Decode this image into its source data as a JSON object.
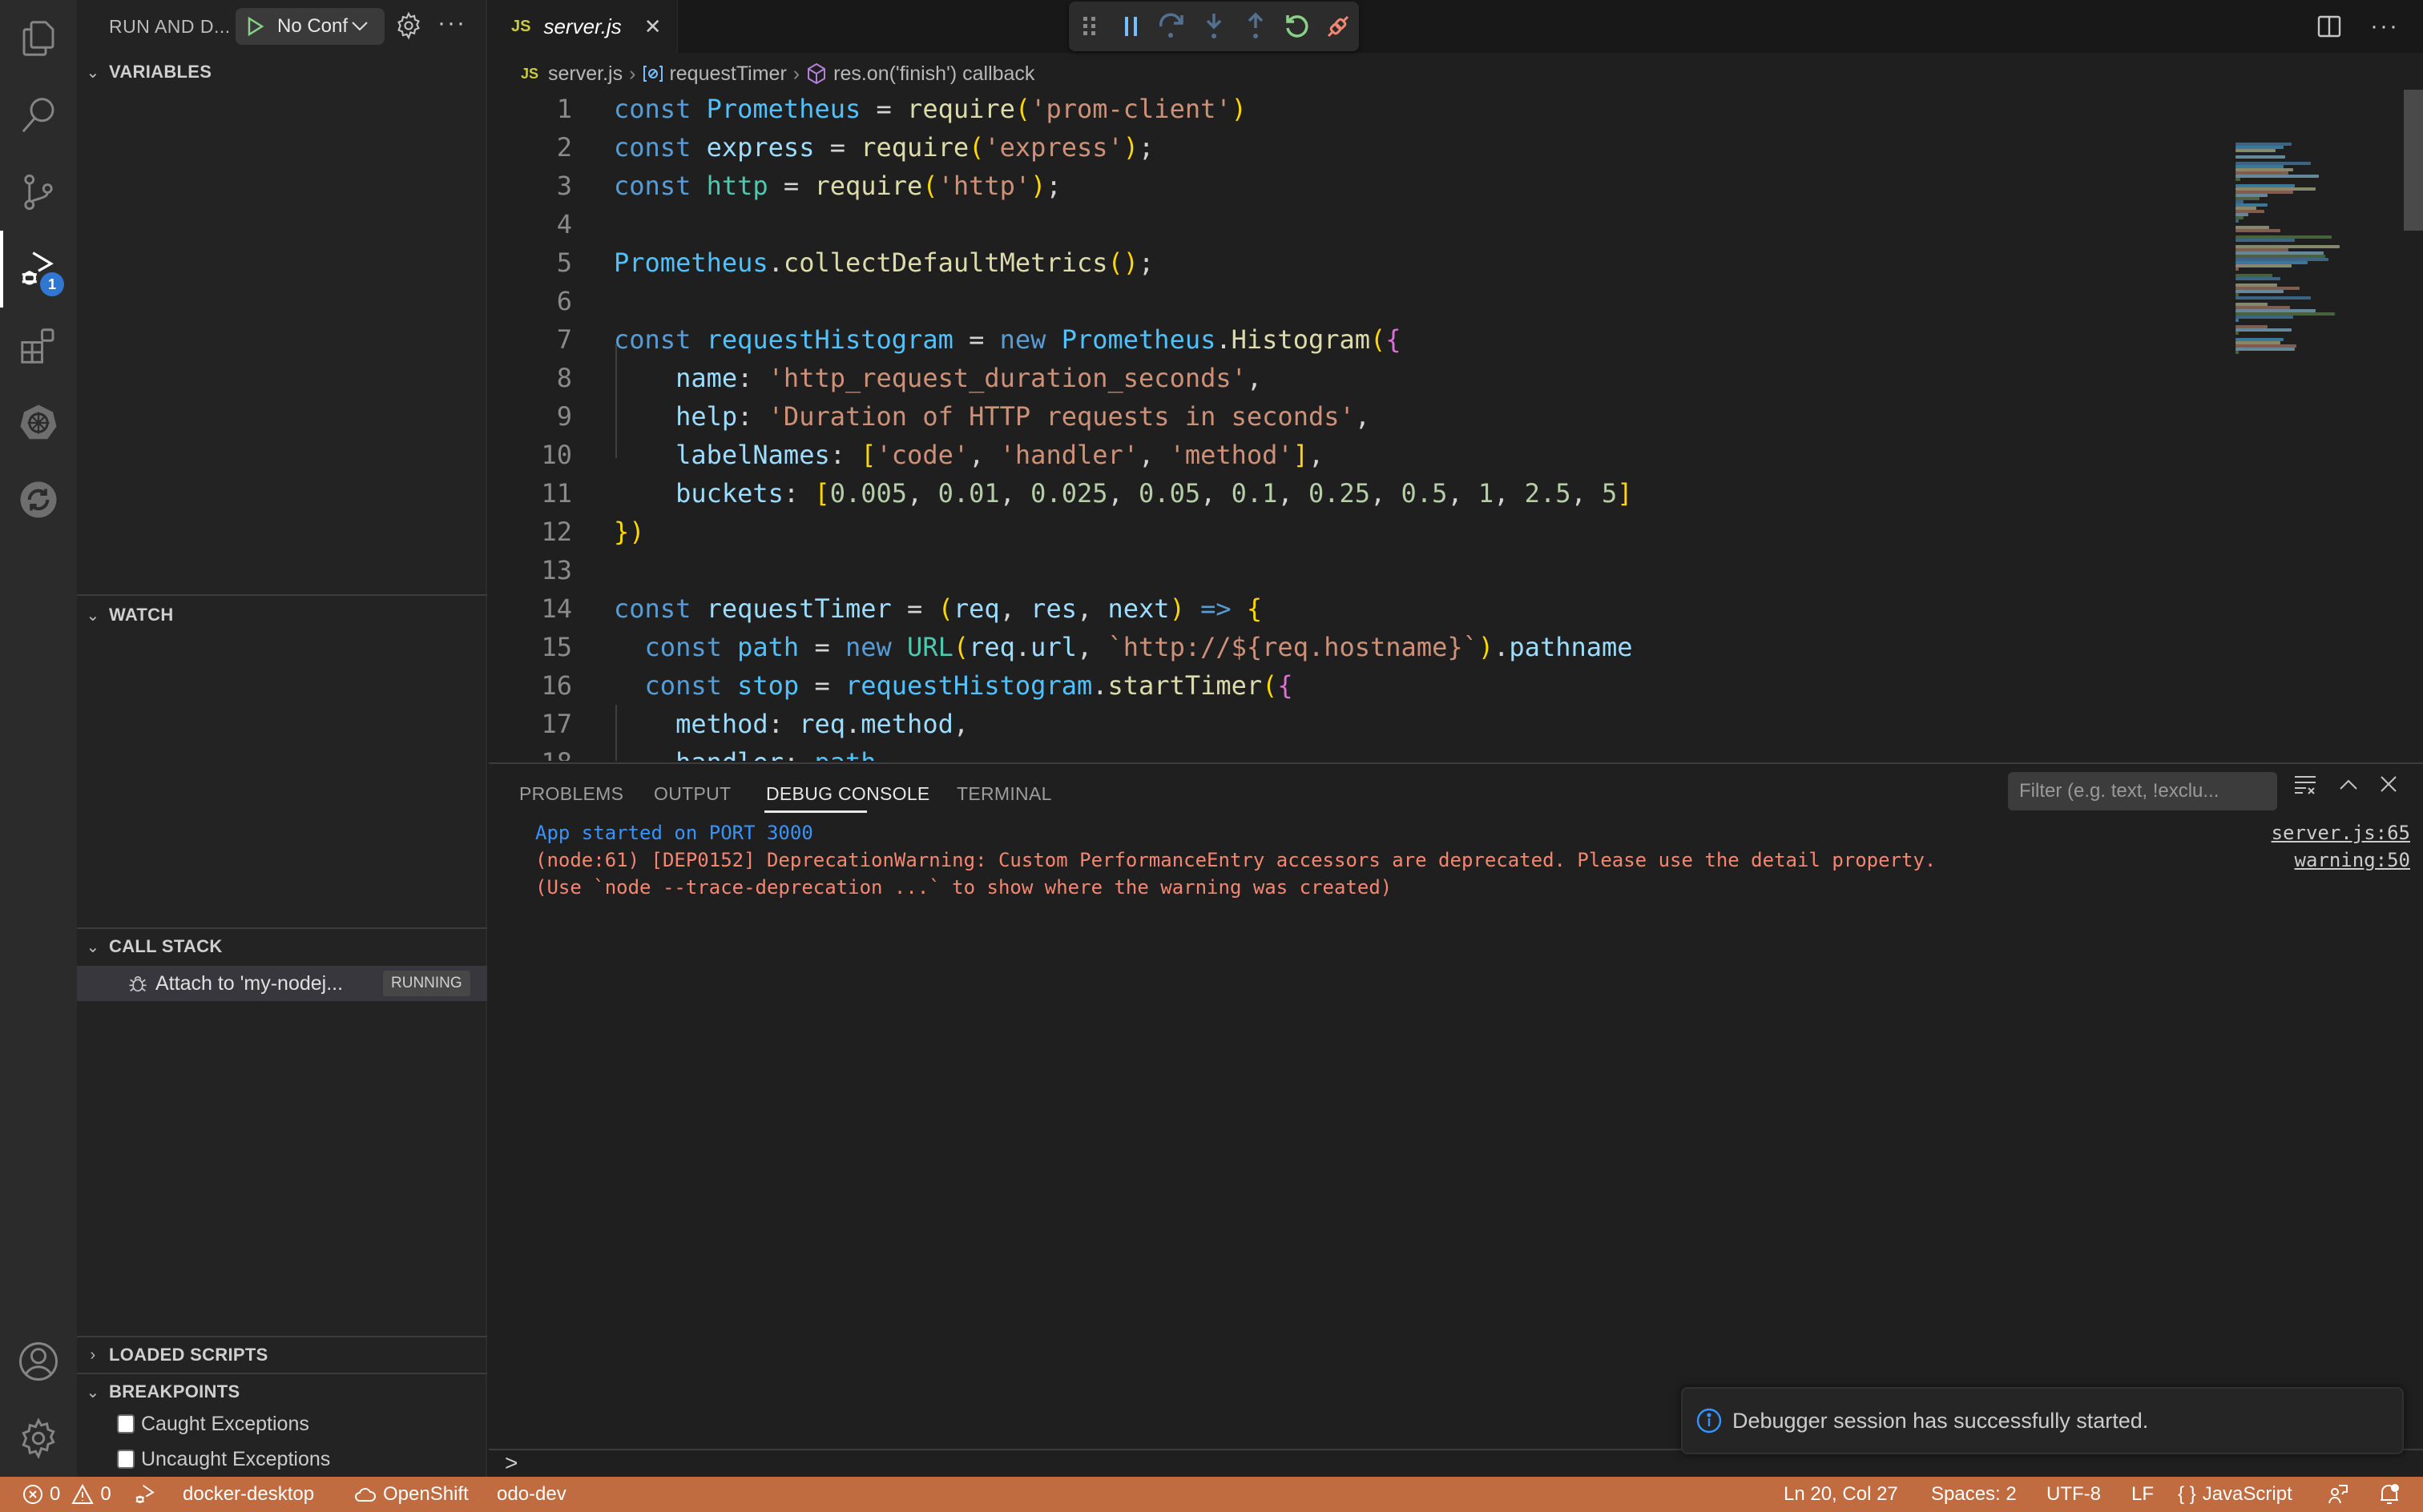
{
  "activity_bar": {
    "items": [
      {
        "name": "explorer",
        "icon": "files-icon"
      },
      {
        "name": "search",
        "icon": "search-icon"
      },
      {
        "name": "source-control",
        "icon": "source-control-icon"
      },
      {
        "name": "run-and-debug",
        "icon": "run-debug-icon",
        "active": true,
        "badge": "1"
      },
      {
        "name": "extensions",
        "icon": "extensions-icon"
      },
      {
        "name": "kubernetes",
        "icon": "kubernetes-icon"
      },
      {
        "name": "openshift",
        "icon": "openshift-sync-icon"
      }
    ],
    "bottom": [
      {
        "name": "accounts",
        "icon": "account-icon"
      },
      {
        "name": "manage",
        "icon": "gear-icon"
      }
    ],
    "debug_badge": "1"
  },
  "sidebar": {
    "title": "RUN AND D...",
    "config_label": "No Conf",
    "sections": {
      "variables": "VARIABLES",
      "watch": "WATCH",
      "call_stack": "CALL STACK",
      "loaded_scripts": "LOADED SCRIPTS",
      "breakpoints": "BREAKPOINTS"
    },
    "call_stack_items": [
      {
        "label": "Attach to 'my-nodej...",
        "status": "RUNNING"
      }
    ],
    "breakpoints": [
      {
        "label": "Caught Exceptions",
        "checked": false
      },
      {
        "label": "Uncaught Exceptions",
        "checked": false
      }
    ]
  },
  "editor": {
    "tab": {
      "icon_label": "JS",
      "filename": "server.js"
    },
    "breadcrumb": {
      "file_icon": "JS",
      "items": [
        "server.js",
        "requestTimer",
        "res.on('finish') callback"
      ]
    },
    "current_line": 20,
    "lines": [
      "const Prometheus = require('prom-client')",
      "const express = require('express');",
      "const http = require('http');",
      "",
      "Prometheus.collectDefaultMetrics();",
      "",
      "const requestHistogram = new Prometheus.Histogram({",
      "    name: 'http_request_duration_seconds',",
      "    help: 'Duration of HTTP requests in seconds',",
      "    labelNames: ['code', 'handler', 'method'],",
      "    buckets: [0.005, 0.01, 0.025, 0.05, 0.1, 0.25, 0.5, 1, 2.5, 5]",
      "})",
      "",
      "const requestTimer = (req, res, next) => {",
      "  const path = new URL(req.url, `http://${req.hostname}`).pathname",
      "  const stop = requestHistogram.startTimer({",
      "    method: req.method,",
      "    handler: path"
    ]
  },
  "panel": {
    "tabs": [
      "PROBLEMS",
      "OUTPUT",
      "DEBUG CONSOLE",
      "TERMINAL"
    ],
    "active_tab": "DEBUG CONSOLE",
    "filter_placeholder": "Filter (e.g. text, !exclu...",
    "console_lines": [
      {
        "text": "App started on PORT 3000",
        "source": "server.js:65",
        "color": "#3794ff"
      },
      {
        "text": "(node:61) [DEP0152] DeprecationWarning: Custom PerformanceEntry accessors are deprecated. Please use the detail property.",
        "source": "warning:50",
        "color": "#f48771"
      },
      {
        "text": "(Use `node --trace-deprecation ...` to show where the warning was created)",
        "source": "",
        "color": "#f48771"
      }
    ],
    "repl_prompt": ">"
  },
  "notification": {
    "message": "Debugger session has successfully started.",
    "icon": "info-icon"
  },
  "statusbar": {
    "errors": "0",
    "warnings": "0",
    "kube_context": "docker-desktop",
    "openshift": "OpenShift",
    "namespace": "odo-dev",
    "cursor": "Ln 20, Col 27",
    "indent": "Spaces: 2",
    "encoding": "UTF-8",
    "eol": "LF",
    "language": "JavaScript",
    "background_color": "#c06b40"
  },
  "colors": {
    "accent": "#2f77d1",
    "debug_status": "#c06b40",
    "console_info": "#3794ff",
    "console_warning": "#f48771"
  }
}
